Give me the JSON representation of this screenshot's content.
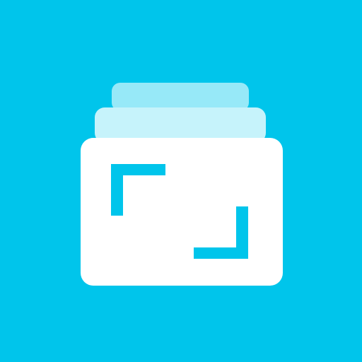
{
  "icon": {
    "name": "gallery-stack-icon",
    "colors": {
      "background": "#00C5EB",
      "card_front": "#FFFFFF",
      "card_middle": "#C6F3FB",
      "card_back": "#97E9F8",
      "crop_marks": "#00C5EB"
    }
  }
}
